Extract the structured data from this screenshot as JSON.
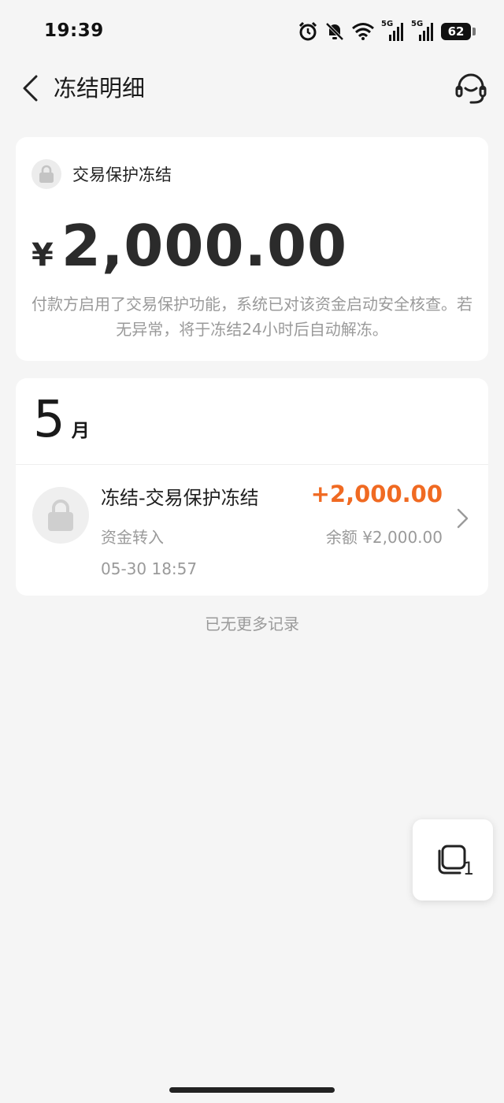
{
  "status_bar": {
    "time": "19:39",
    "icons": [
      "alarm-icon",
      "mute-bell-icon",
      "wifi-icon",
      "signal-5g-icon",
      "signal-5g-icon"
    ],
    "network_label_1": "5G",
    "network_label_2": "5G",
    "battery": "62"
  },
  "header": {
    "title": "冻结明细",
    "back_icon": "chevron-left-icon",
    "support_icon": "headset-icon"
  },
  "summary": {
    "type_label": "交易保护冻结",
    "currency": "¥",
    "amount": "2,000.00",
    "notice": "付款方启用了交易保护功能，系统已对该资金启动安全核查。若无异常，将于冻结24小时后自动解冻。"
  },
  "records": {
    "month_number": "5",
    "month_unit": "月",
    "items": [
      {
        "title": "冻结-交易保护冻结",
        "subtitle": "资金转入",
        "time": "05-30 18:57",
        "amount": "+2,000.00",
        "balance": "余额 ¥2,000.00"
      }
    ],
    "end_note": "已无更多记录"
  },
  "float_window": {
    "count": "1"
  },
  "colors": {
    "accent_orange": "#f06a22",
    "background": "#f5f5f5",
    "muted_text": "#9a9a9a"
  }
}
